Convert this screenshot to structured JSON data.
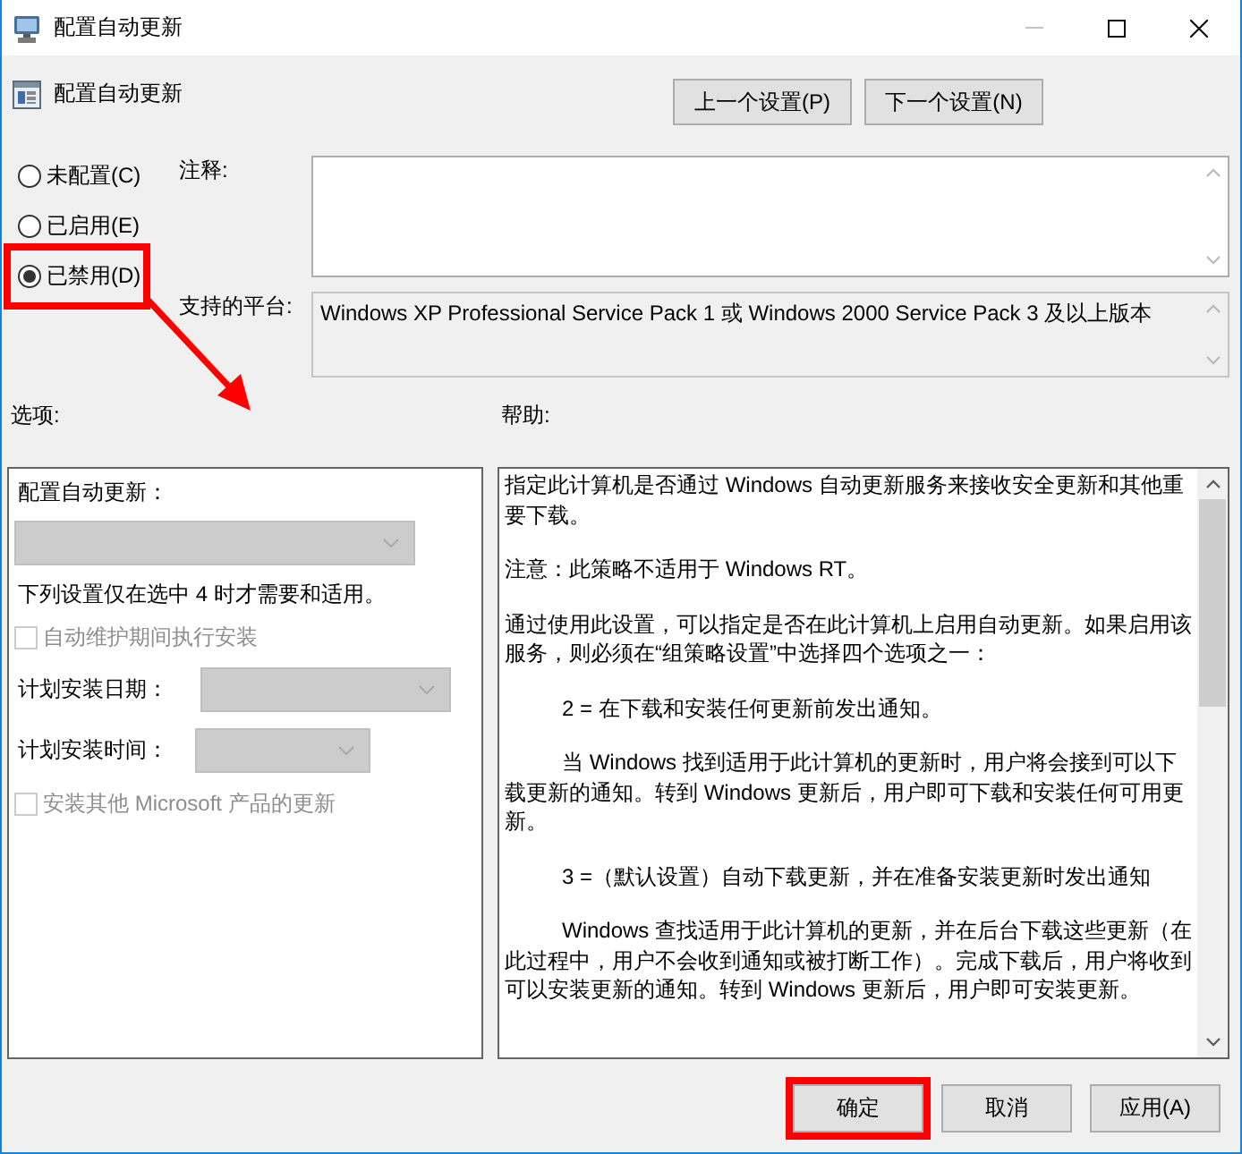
{
  "window": {
    "title": "配置自动更新",
    "minimize_disabled": true
  },
  "header": {
    "title": "配置自动更新",
    "buttons": [
      "上一个设置(P)",
      "下一个设置(N)"
    ]
  },
  "states": [
    {
      "label": "未配置(C)",
      "selected": false,
      "highlighted": false
    },
    {
      "label": "已启用(E)",
      "selected": false,
      "highlighted": false
    },
    {
      "label": "已禁用(D)",
      "selected": true,
      "highlighted": true
    }
  ],
  "comment": {
    "label": "注释:"
  },
  "platform": {
    "label": "支持的平台:",
    "text": "Windows XP Professional Service Pack 1 或 Windows 2000 Service Pack 3 及以上版本"
  },
  "options": {
    "heading": "选项:",
    "items": [
      {
        "kind": "label",
        "text": "配置自动更新："
      },
      {
        "kind": "dropdown",
        "disabled": true
      },
      {
        "kind": "note",
        "text": "下列设置仅在选中 4 时才需要和适用。"
      },
      {
        "kind": "checkbox",
        "label": "自动维护期间执行安装",
        "checked": false,
        "disabled": true
      },
      {
        "kind": "dropdown",
        "label": "计划安装日期：",
        "disabled": true
      },
      {
        "kind": "dropdown",
        "label": "计划安装时间：",
        "disabled": true
      },
      {
        "kind": "checkbox",
        "label": "安装其他 Microsoft 产品的更新",
        "checked": false,
        "disabled": true
      }
    ]
  },
  "help": {
    "heading": "帮助:",
    "paragraphs": [
      {
        "text": "指定此计算机是否通过 Windows 自动更新服务来接收安全更新和其他重要下载。",
        "indented": false
      },
      {
        "text": "注意：此策略不适用于 Windows RT。",
        "indented": false
      },
      {
        "text": "通过使用此设置，可以指定是否在此计算机上启用自动更新。如果启用该服务，则必须在“组策略设置”中选择四个选项之一：",
        "indented": false
      },
      {
        "text": "2 = 在下载和安装任何更新前发出通知。",
        "indented": true
      },
      {
        "text": "当 Windows 找到适用于此计算机的更新时，用户将会接到可以下载更新的通知。转到 Windows 更新后，用户即可下载和安装任何可用更新。",
        "indented": true
      },
      {
        "text": "3 =（默认设置）自动下载更新，并在准备安装更新时发出通知",
        "indented": true
      },
      {
        "text": "Windows 查找适用于此计算机的更新，并在后台下载这些更新（在此过程中，用户不会收到通知或被打断工作）。完成下载后，用户将收到可以安装更新的通知。转到 Windows 更新后，用户即可安装更新。",
        "indented": true
      }
    ]
  },
  "buttons": [
    {
      "label": "确定",
      "highlighted": true
    },
    {
      "label": "取消",
      "highlighted": false
    },
    {
      "label": "应用(A)",
      "highlighted": false
    }
  ]
}
